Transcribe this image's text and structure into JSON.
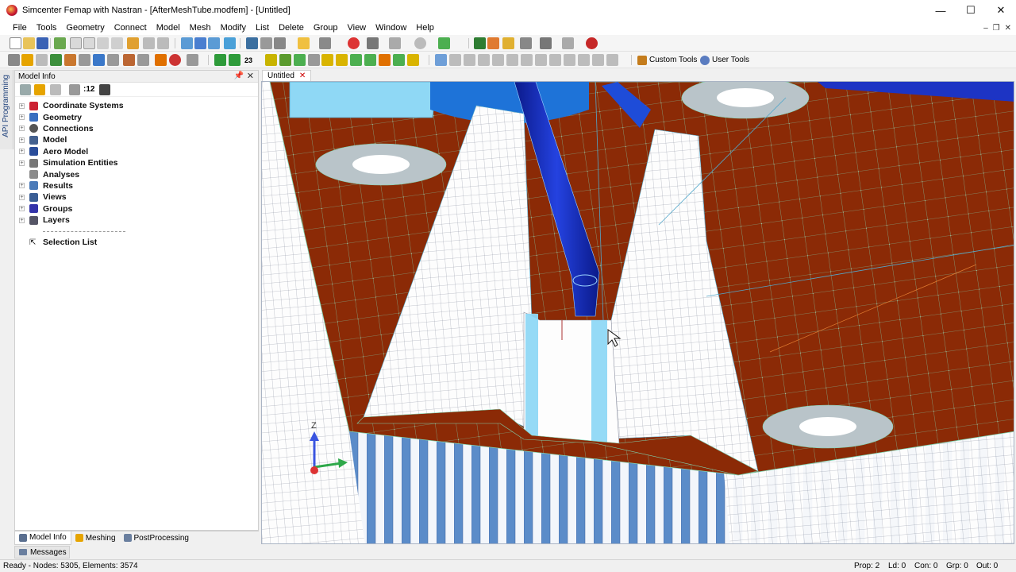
{
  "window": {
    "title": "Simcenter Femap with Nastran - [AfterMeshTube.modfem] - [Untitled]",
    "controls": [
      "—",
      "☐",
      "✕"
    ]
  },
  "menu": [
    "File",
    "Tools",
    "Geometry",
    "Connect",
    "Model",
    "Mesh",
    "Modify",
    "List",
    "Delete",
    "Group",
    "View",
    "Window",
    "Help"
  ],
  "toolbar2": {
    "custom_tools": "Custom Tools",
    "user_tools": "User Tools",
    "count_label": "23"
  },
  "side_tab": "API Programming",
  "model_info": {
    "title": "Model Info",
    "count": ":12",
    "tree": [
      {
        "label": "Coordinate Systems",
        "icon": "axes-icon"
      },
      {
        "label": "Geometry",
        "icon": "geometry-icon"
      },
      {
        "label": "Connections",
        "icon": "connections-icon"
      },
      {
        "label": "Model",
        "icon": "model-icon"
      },
      {
        "label": "Aero Model",
        "icon": "aero-icon"
      },
      {
        "label": "Simulation Entities",
        "icon": "simulation-icon"
      },
      {
        "label": "Analyses",
        "icon": "analyses-icon"
      },
      {
        "label": "Results",
        "icon": "results-icon"
      },
      {
        "label": "Views",
        "icon": "views-icon"
      },
      {
        "label": "Groups",
        "icon": "groups-icon"
      },
      {
        "label": "Layers",
        "icon": "layers-icon"
      }
    ],
    "selection_list": "Selection List"
  },
  "panel_tabs": [
    "Model Info",
    "Meshing",
    "PostProcessing"
  ],
  "messages_tab": "Messages",
  "doc_tab": "Untitled",
  "axis_label": "Z",
  "status": {
    "left": "Ready - Nodes: 5305, Elements: 3574",
    "prop": "Prop: 2",
    "ld": "Ld: 0",
    "con": "Con: 0",
    "grp": "Grp: 0",
    "out": "Out: 0"
  },
  "colors": {
    "plate": "#8b2a06",
    "mesh_line": "#7fd4b0",
    "solid": "#fdfdfd",
    "tube": "#1d34c4",
    "highlight": "#8fd8f5"
  }
}
